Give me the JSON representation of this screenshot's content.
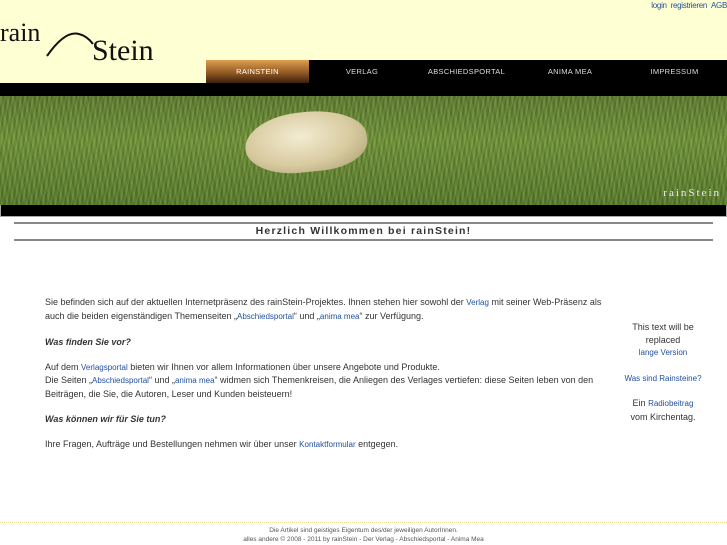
{
  "top_links": [
    "login",
    "registrieren",
    "AGB"
  ],
  "logo": {
    "part1": "rain",
    "part2": "Stein"
  },
  "nav": [
    {
      "label": "RAINSTEIN",
      "active": true
    },
    {
      "label": "VERLAG"
    },
    {
      "label": "ABSCHIEDSPORTAL"
    },
    {
      "label": "ANIMA MEA"
    },
    {
      "label": "IMPRESSUM"
    }
  ],
  "banner_text": "rainStein",
  "welcome": "Herzlich Willkommen bei rainStein!",
  "content": {
    "p1a": "Sie befinden sich auf der aktuellen Internetpräsenz des rainStein-Projektes. Ihnen stehen hier sowohl der ",
    "p1_link1": "Verlag",
    "p1b": " mit seiner Web-Präsenz als auch die beiden eigenständigen Themenseiten „",
    "p1_link2": "Abschiedsportal",
    "p1c": "“ und „",
    "p1_link3": "anima mea",
    "p1d": "“ zur Verfügung.",
    "q1": "Was finden Sie vor?",
    "p2a": "Auf dem ",
    "p2_link1": "Verlagsportal",
    "p2b": " bieten wir Ihnen vor allem Informationen über unsere Angebote und Produkte.",
    "p2c": "Die Seiten  „",
    "p2_link2": "Abschiedsportal",
    "p2d": "“ und „",
    "p2_link3": "anima mea",
    "p2e": "“ widmen sich Themenkreisen, die Anliegen des Verlages vertiefen: diese Seiten leben von den Beiträgen, die Sie, die Autoren, Leser und Kunden beisteuern!",
    "q2": "Was können wir für Sie tun?",
    "p3a": "Ihre Fragen, Aufträge und Bestellungen nehmen wir über unser ",
    "p3_link": "Kontaktformular",
    "p3b": " entgegen."
  },
  "sidebar": {
    "text1": "This text will be replaced",
    "link1": "lange Version",
    "link2": "Was sind Rainsteine?",
    "text2a": "Ein ",
    "link3": "Radiobeitrag",
    "text2b": "vom Kirchentag."
  },
  "footer": {
    "line1": "Die Artikel sind geistiges Eigentum des/der jeweiligen AutorInnen.",
    "line2": "alles andere © 2008 - 2011 by rainStein - Der Verlag - Abschiedsportal - Anima Mea"
  }
}
